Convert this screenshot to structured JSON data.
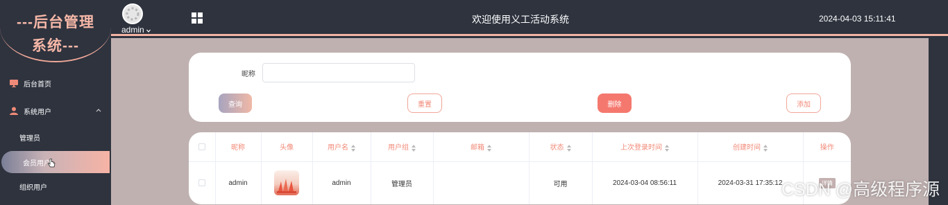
{
  "logo": {
    "line1": "---后台管理",
    "line2": "系统---"
  },
  "sidebar": {
    "items": [
      {
        "label": "后台首页"
      },
      {
        "label": "系统用户"
      },
      {
        "label": "管理员"
      },
      {
        "label": "会员用户"
      },
      {
        "label": "组织用户"
      }
    ]
  },
  "header": {
    "username": "admin",
    "title": "欢迎使用义工活动系统",
    "datetime": "2024-04-03 15:11:41"
  },
  "search": {
    "nickname_label": "昵称",
    "nickname_value": "",
    "query_label": "查询",
    "reset_label": "重置",
    "delete_label": "删除",
    "add_label": "添加"
  },
  "table": {
    "columns": [
      "昵称",
      "头像",
      "用户名",
      "用户组",
      "邮箱",
      "状态",
      "上次登录时间",
      "创建时间",
      "操作"
    ],
    "rows": [
      {
        "nickname": "admin",
        "username": "admin",
        "group": "管理员",
        "email": "",
        "status": "可用",
        "last_login": "2024-03-04 08:56:11",
        "created": "2024-03-31 17:35:12",
        "action": "详情"
      }
    ]
  },
  "watermark": "CSDN @高级程序源",
  "colors": {
    "accent": "#f28a78",
    "danger": "#f5786e",
    "sidebar_bg": "#2e333e",
    "main_bg": "#c0b1b1"
  }
}
